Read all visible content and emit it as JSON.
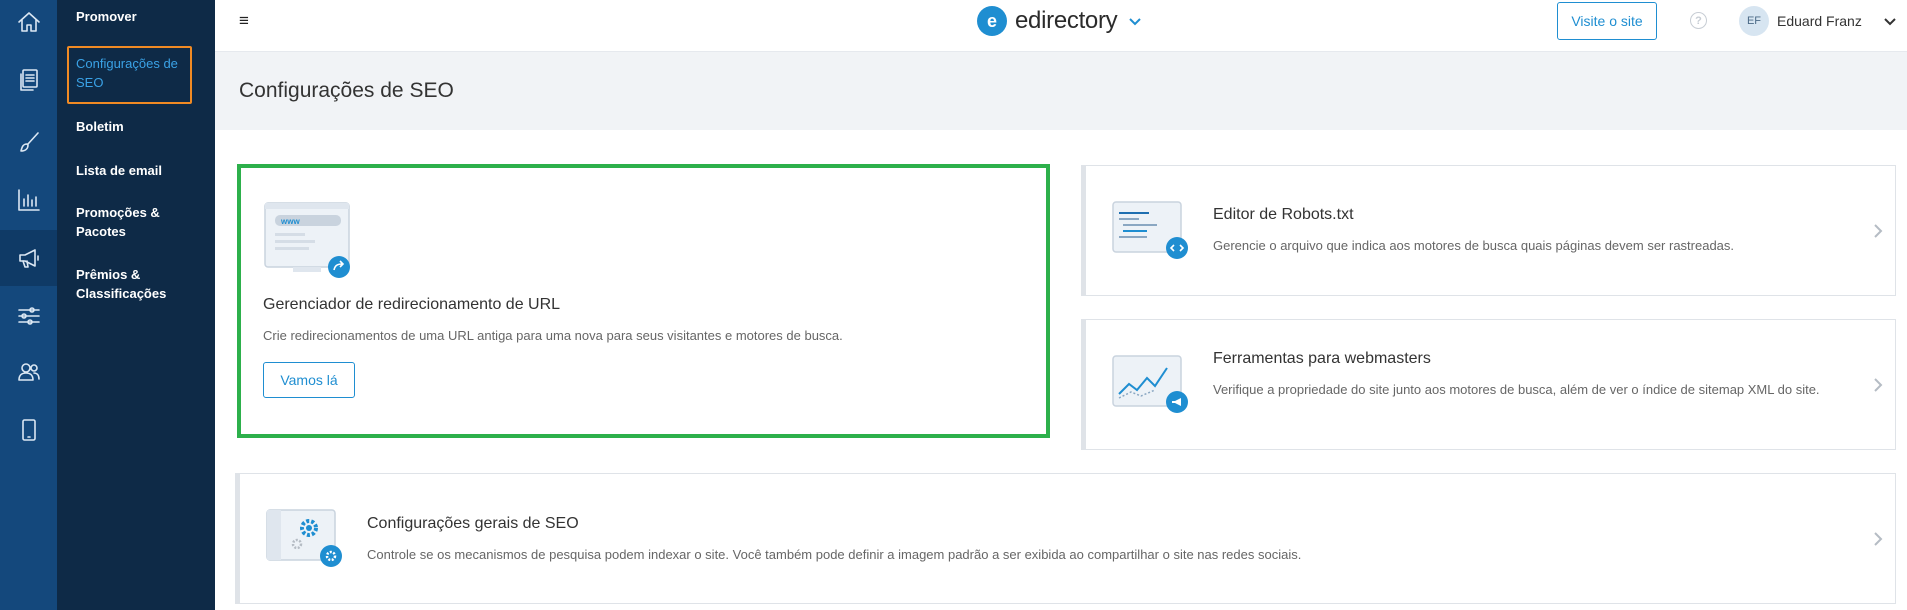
{
  "rail": {
    "items": [
      {
        "icon": "home-icon"
      },
      {
        "icon": "pages-icon"
      },
      {
        "icon": "brush-icon"
      },
      {
        "icon": "chart-icon"
      },
      {
        "icon": "megaphone-icon"
      },
      {
        "icon": "sliders-icon"
      },
      {
        "icon": "users-icon"
      },
      {
        "icon": "mobile-icon"
      }
    ]
  },
  "subnav": {
    "items": [
      {
        "label": "Promover"
      },
      {
        "label": "Configurações de SEO"
      },
      {
        "label": "Boletim"
      },
      {
        "label": "Lista de email"
      },
      {
        "label": "Promoções & Pacotes"
      },
      {
        "label": "Prêmios & Classificações"
      }
    ]
  },
  "topbar": {
    "brand_letter": "e",
    "brand_name": "edirectory",
    "visit_label": "Visite o site",
    "help_symbol": "?",
    "user_initials": "EF",
    "user_name": "Eduard Franz"
  },
  "page": {
    "title": "Configurações de SEO"
  },
  "cards": {
    "redirect": {
      "illus_text": "www",
      "title": "Gerenciador de redirecionamento de URL",
      "desc": "Crie redirecionamentos de uma URL antiga para uma nova para seus visitantes e motores de busca.",
      "button": "Vamos lá"
    },
    "robots": {
      "title": "Editor de Robots.txt",
      "desc": "Gerencie o arquivo que indica aos motores de busca quais páginas devem ser rastreadas."
    },
    "webmaster": {
      "title": "Ferramentas para webmasters",
      "desc": "Verifique a propriedade do site junto aos motores de busca, além de ver o índice de sitemap XML do site."
    },
    "general": {
      "title": "Configurações gerais de SEO",
      "desc": "Controle se os mecanismos de pesquisa podem indexar o site. Você também pode definir a imagem padrão a ser exibida ao compartilhar o site nas redes sociais."
    }
  },
  "colors": {
    "rail_bg": "#14487c",
    "subnav_bg": "#0e2a47",
    "accent": "#1f8ed1",
    "highlight_orange": "#f08a24",
    "highlight_green": "#2db04b"
  }
}
